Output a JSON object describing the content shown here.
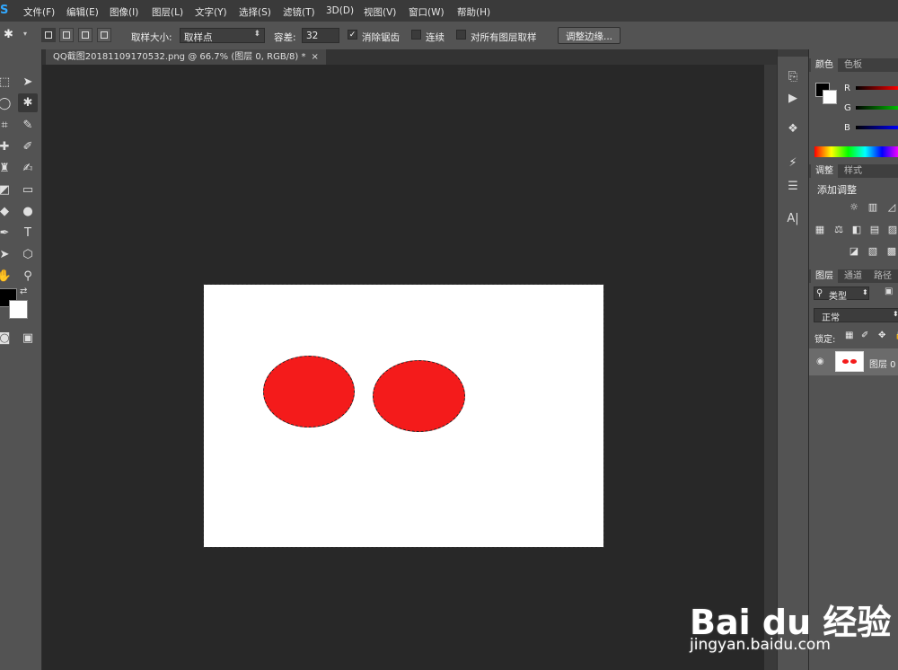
{
  "app": {
    "logo": "S"
  },
  "menu": [
    "文件(F)",
    "编辑(E)",
    "图像(I)",
    "图层(L)",
    "文字(Y)",
    "选择(S)",
    "滤镜(T)",
    "3D(D)",
    "视图(V)",
    "窗口(W)",
    "帮助(H)"
  ],
  "options": {
    "sample_size_label": "取样大小:",
    "sample_size_value": "取样点",
    "tolerance_label": "容差:",
    "tolerance_value": "32",
    "antialias_label": "消除锯齿",
    "antialias_checked": true,
    "contiguous_label": "连续",
    "contiguous_checked": false,
    "sample_all_label": "对所有图层取样",
    "sample_all_checked": false,
    "refine_edge_label": "调整边缘..."
  },
  "document": {
    "tab_title": "QQ截图20181109170532.png @ 66.7% (图层 0, RGB/8) *",
    "close": "×",
    "background": "#ffffff",
    "shape_color": "#f41b1b"
  },
  "panels": {
    "color_tabs": [
      "颜色",
      "色板"
    ],
    "channels": [
      "R",
      "G",
      "B"
    ],
    "adjust_tabs": [
      "调整",
      "样式"
    ],
    "add_adjustment": "添加调整",
    "layers_tabs": [
      "图层",
      "通道",
      "路径"
    ],
    "filter_kind": "类型",
    "blend_mode": "正常",
    "lock_label": "锁定:",
    "layer_name": "图层 0"
  },
  "watermark": {
    "brand": "Bai du 经验",
    "url": "jingyan.baidu.com"
  }
}
